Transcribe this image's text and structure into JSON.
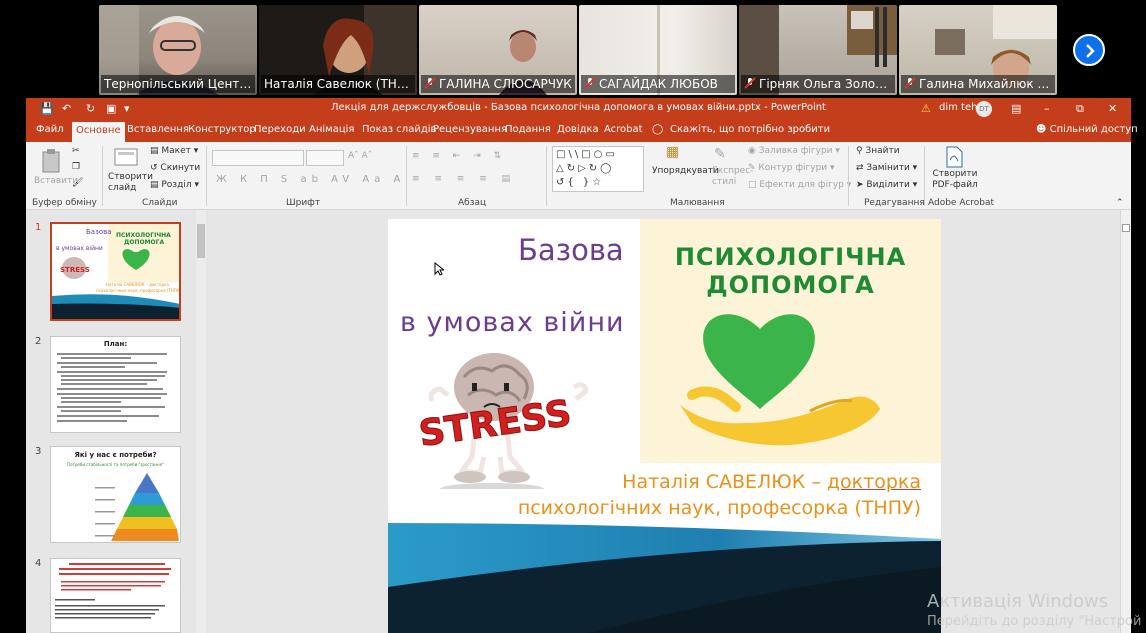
{
  "participants": [
    {
      "name": "Тернопільський Центр ...",
      "muted": false,
      "active": false
    },
    {
      "name": "Наталія Савелюк (ТНПУ)",
      "muted": false,
      "active": true
    },
    {
      "name": "ГАЛИНА СЛЮСАРЧУК",
      "muted": true,
      "active": false
    },
    {
      "name": "САГАЙДАК ЛЮБОВ",
      "muted": true,
      "active": false
    },
    {
      "name": "Гірняк Ольга Золото...",
      "muted": true,
      "active": false
    },
    {
      "name": "Галина Михайлюк В...",
      "muted": true,
      "active": false
    }
  ],
  "window": {
    "title": "Лекція для держслужбовців - Базова психологічна допомога в умовах війни.pptx  -  PowerPoint",
    "user": "dim teh",
    "user_initials": "DT"
  },
  "menu": {
    "items": [
      "Файл",
      "Основне",
      "Вставлення",
      "Конструктор",
      "Переходи",
      "Анімація",
      "Показ слайдів",
      "Рецензування",
      "Подання",
      "Довідка",
      "Acrobat"
    ],
    "active": "Основне",
    "tell_me": "Скажіть, що потрібно зробити",
    "share": "Спільний доступ"
  },
  "ribbon": {
    "paste": "Вставити",
    "new_slide": "Створити слайд",
    "layout": "Макет",
    "reset": "Скинути",
    "section": "Розділ",
    "arrange": "Упорядкувати",
    "quick_styles": "Експрес-стилі",
    "shape_fill": "Заливка фігури",
    "shape_outline": "Контур фігури",
    "shape_effects": "Ефекти для фігур",
    "find": "Знайти",
    "replace": "Замінити",
    "select": "Виділити",
    "create_pdf": "Створити PDF-файл",
    "groups": {
      "clipboard": "Буфер обміну",
      "slides": "Слайди",
      "font": "Шрифт",
      "paragraph": "Абзац",
      "drawing": "Малювання",
      "editing": "Редагування",
      "acrobat": "Adobe Acrobat"
    }
  },
  "thumbnails": [
    {
      "number": "1",
      "selected": true
    },
    {
      "number": "2",
      "selected": false,
      "title": "План:"
    },
    {
      "number": "3",
      "selected": false,
      "title": "Які у нас є потреби?",
      "subtitle": "Потреби стабільності та потреби \"зростання\""
    },
    {
      "number": "4",
      "selected": false
    }
  ],
  "slide": {
    "title_a": "Базова",
    "title_b": "в умовах війни",
    "green_title_1": "ПСИХОЛОГІЧНА",
    "green_title_2": "ДОПОМОГА",
    "stress": "STRESS",
    "author_line1_a": "Наталія САВЕЛЮК – ",
    "author_line1_b": "докторка",
    "author_line2": "психологічних наук, професорка (ТНПУ)"
  },
  "watermark": {
    "line1": "Активація Windows",
    "line2": "Перейдіть до розділу \"Настрой"
  }
}
